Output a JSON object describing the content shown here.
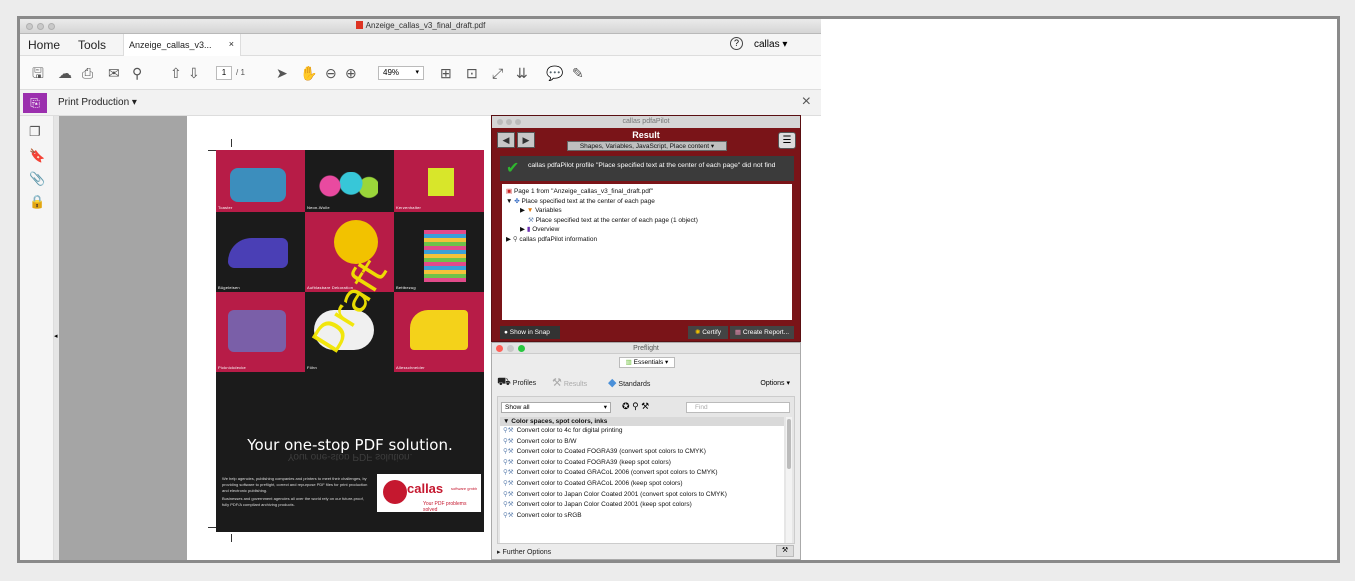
{
  "window": {
    "title": "Anzeige_callas_v3_final_draft.pdf"
  },
  "menubar": {
    "home": "Home",
    "tools": "Tools",
    "doc_tab": "Anzeige_callas_v3...",
    "close_tab": "×",
    "help": "?",
    "user": "callas"
  },
  "toolbar": {
    "page_current": "1",
    "page_total": "/ 1",
    "zoom": "49%"
  },
  "print_production": {
    "label": "Print Production",
    "close": "×"
  },
  "poster": {
    "cells": [
      "Toaster",
      "Neon-Wolle",
      "Kerzenhalter",
      "Bügeleisen",
      "Aufblasbare Dekoration",
      "Bettbezug",
      "Picknickdecke",
      "Föhn",
      "Allesschneider"
    ],
    "headline": "Your one-stop PDF solution.",
    "body1": "We help agencies, publishing companies and printers to meet their challenges, by providing software to preflight, correct and repurpose PDF files for print production and electronic publishing.",
    "body2": "Businesses and government agencies all over the world rely on our future-proof, fully PDF/A compliant archiving products.",
    "logo": "callas",
    "logo_sub": "software gmbh",
    "logo_tag": "Your PDF problems solved",
    "watermark": "Draft"
  },
  "pilot": {
    "title": "callas pdfaPilot",
    "heading": "Result",
    "selector": "Shapes, Variables, JavaScript, Place content",
    "message": "callas pdfaPilot profile \"Place specified text at the center of each page\" did not find",
    "tree": [
      "Page 1 from \"Anzeige_callas_v3_final_draft.pdf\"",
      "Place specified text at the center of each page",
      "Variables",
      "Place specified text at the center of each page (1 object)",
      "Overview",
      "callas pdfaPilot information"
    ],
    "show_snap": "Show in Snap",
    "certify": "Certify",
    "create_report": "Create Report..."
  },
  "preflight": {
    "title": "Preflight",
    "library": "Essentials",
    "tab_profiles": "Profiles",
    "tab_results": "Results",
    "tab_standards": "Standards",
    "options": "Options",
    "filter": "Show all",
    "find_placeholder": "Find",
    "group": "Color spaces, spot colors, inks",
    "items": [
      "Convert color to 4c for digital printing",
      "Convert color to B/W",
      "Convert color to Coated FOGRA39 (convert spot colors to CMYK)",
      "Convert color to Coated FOGRA39 (keep spot colors)",
      "Convert color to Coated GRACoL 2006 (convert spot colors to CMYK)",
      "Convert color to Coated GRACoL 2006 (keep spot colors)",
      "Convert color to Japan Color Coated 2001 (convert spot colors to CMYK)",
      "Convert color to Japan Color Coated 2001 (keep spot colors)",
      "Convert color to sRGB"
    ],
    "further": "Further Options"
  }
}
